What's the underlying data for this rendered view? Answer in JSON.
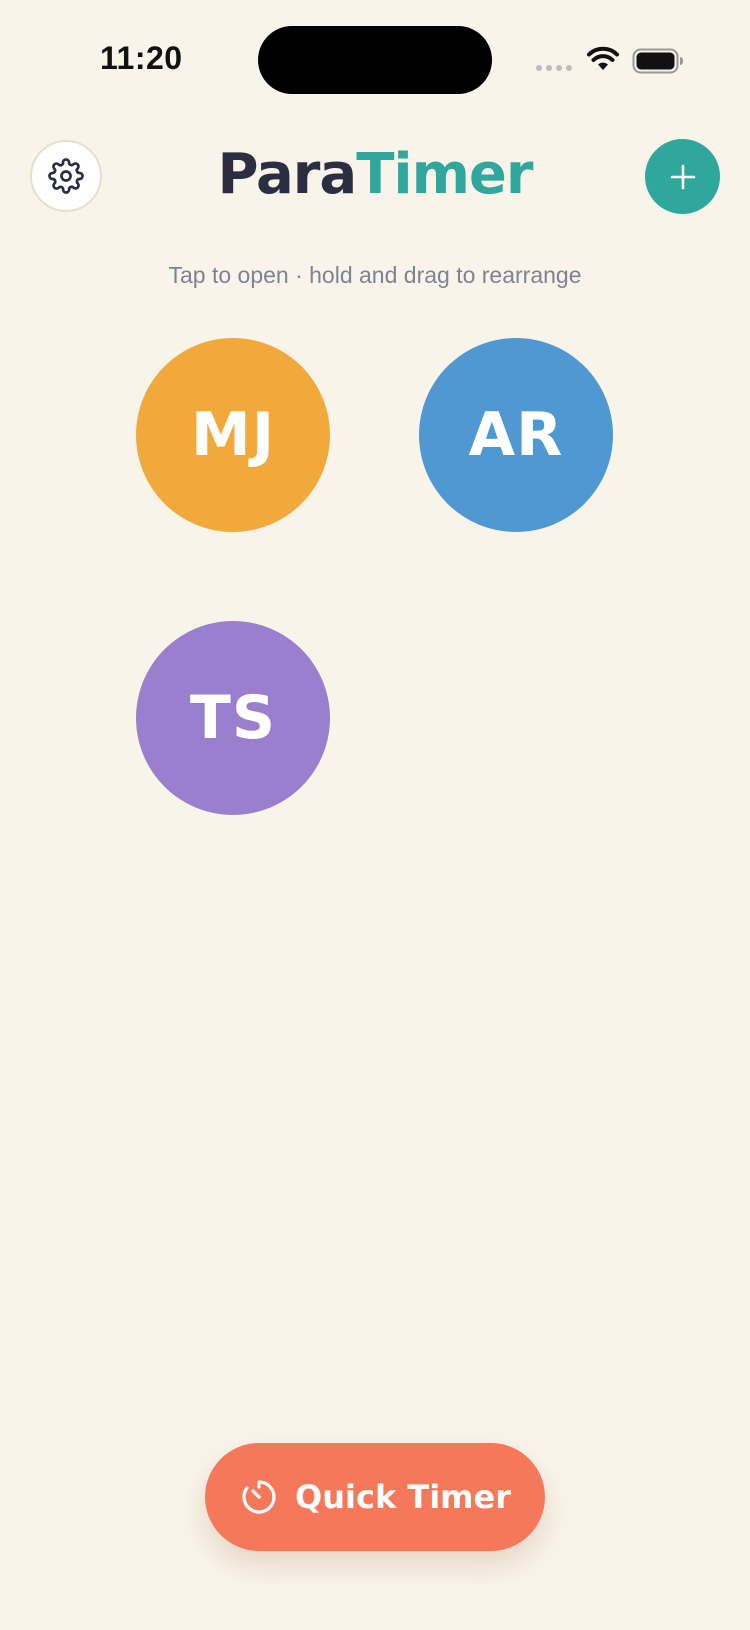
{
  "status_bar": {
    "time": "11:20"
  },
  "header": {
    "title_part_1": "Para",
    "title_part_2": "Timer",
    "title_colors": {
      "primary": "#2B2D42",
      "accent": "#2FA79C"
    },
    "settings_icon": "gear-icon",
    "add_icon": "plus-icon"
  },
  "hint": "Tap to open · hold and drag to rearrange",
  "profiles": [
    {
      "initials": "MJ",
      "color": "#F2A93B"
    },
    {
      "initials": "AR",
      "color": "#4F98D2"
    },
    {
      "initials": "TS",
      "color": "#9A7FCF"
    }
  ],
  "quick_timer": {
    "label": "Quick Timer",
    "icon": "stopwatch-icon",
    "color": "#F5785B"
  }
}
